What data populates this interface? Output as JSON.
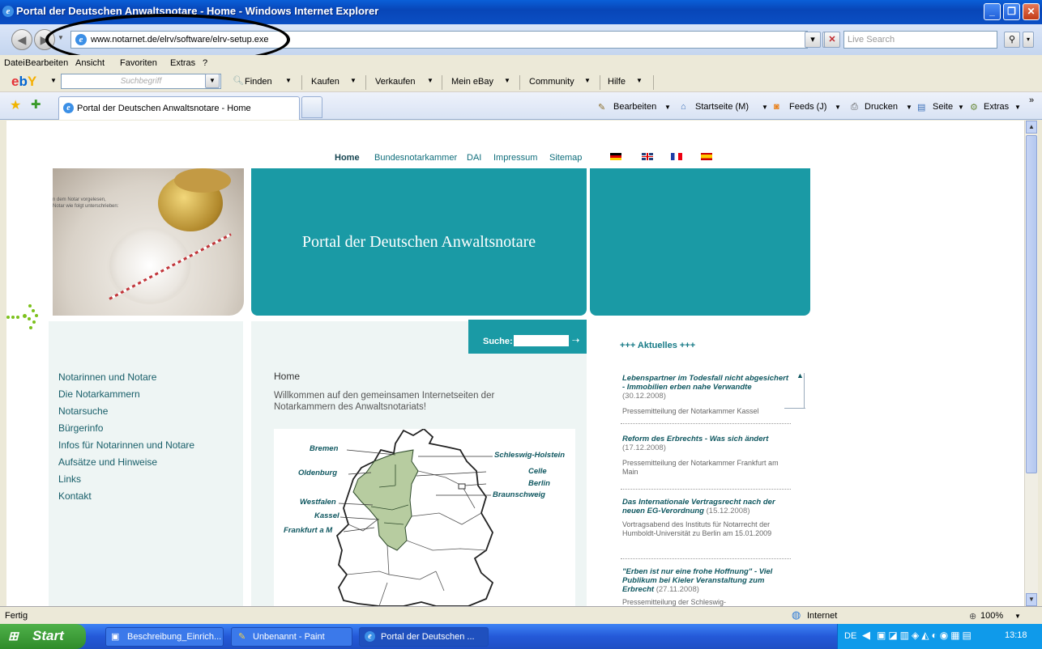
{
  "window": {
    "title": "Portal der Deutschen Anwaltsnotare - Home - Windows Internet Explorer"
  },
  "address_bar": {
    "url": "www.notarnet.de/elrv/software/elrv-setup.exe",
    "search_placeholder": "Live Search"
  },
  "menu": [
    "Datei",
    "Bearbeiten",
    "Ansicht",
    "Favoriten",
    "Extras",
    "?"
  ],
  "ebay_toolbar": {
    "logo": "ebY",
    "search_placeholder": "Suchbegriff",
    "items": [
      "Finden",
      "Kaufen",
      "Verkaufen",
      "Mein eBay",
      "Community",
      "Hilfe"
    ]
  },
  "tab": {
    "label": "Portal der Deutschen Anwaltsnotare - Home"
  },
  "command_bar": [
    "Bearbeiten",
    "Startseite (M)",
    "Feeds (J)",
    "Drucken",
    "Seite",
    "Extras"
  ],
  "site": {
    "topnav": [
      "Home",
      "Bundesnotarkammer",
      "DAI",
      "Impressum",
      "Sitemap"
    ],
    "portal_title": "Portal der Deutschen Anwaltsnotare",
    "search_label": "Suche:",
    "left_nav": [
      "Notarinnen und Notare",
      "Die Notarkammern",
      "Notarsuche",
      "Bürgerinfo",
      "Infos für Notarinnen und Notare",
      "Aufsätze und Hinweise",
      "Links",
      "Kontakt"
    ],
    "home_heading": "Home",
    "welcome_text": "Willkommen auf den gemeinsamen Internetseiten der Notarkammern des Anwaltsnotariats!",
    "map_cities": [
      "Bremen",
      "Oldenburg",
      "Westfalen",
      "Kassel",
      "Frankfurt a M",
      "Schleswig-Holstein",
      "Celle",
      "Berlin",
      "Braunschweig"
    ],
    "aktuelles_heading": "+++ Aktuelles +++",
    "news": [
      {
        "title": "Lebenspartner im Todesfall nicht abgesichert - Immobilien erben nahe Verwandte",
        "date": "(30.12.2008)",
        "source": "Pressemitteilung der Notarkammer Kassel"
      },
      {
        "title": "Reform des Erbrechts - Was sich ändert",
        "date": "(17.12.2008)",
        "source": "Pressemitteilung der Notarkammer Frankfurt am Main"
      },
      {
        "title": "Das Internationale Vertragsrecht nach der neuen EG-Verordnung",
        "date": "(15.12.2008)",
        "source": "Vortragsabend des Instituts für Notarrecht der Humboldt-Universität zu Berlin am 15.01.2009"
      },
      {
        "title": "\"Erben ist nur eine frohe Hoffnung\" - Viel Publikum bei Kieler Veranstaltung zum Erbrecht",
        "date": "(27.11.2008)",
        "source": "Pressemitteilung der Schleswig-"
      }
    ]
  },
  "status_bar": {
    "left": "Fertig",
    "zone": "Internet",
    "zoom": "100%"
  },
  "taskbar": {
    "start": "Start",
    "tasks": [
      "Beschreibung_Einrich...",
      "Unbenannt - Paint",
      "Portal der Deutschen ..."
    ],
    "lang": "DE",
    "clock": "13:18"
  },
  "colors": {
    "teal": "#1a9aa5",
    "title_blue": "#0846b8",
    "taskbar_blue": "#2459d8",
    "start_green": "#2f8c2a"
  }
}
